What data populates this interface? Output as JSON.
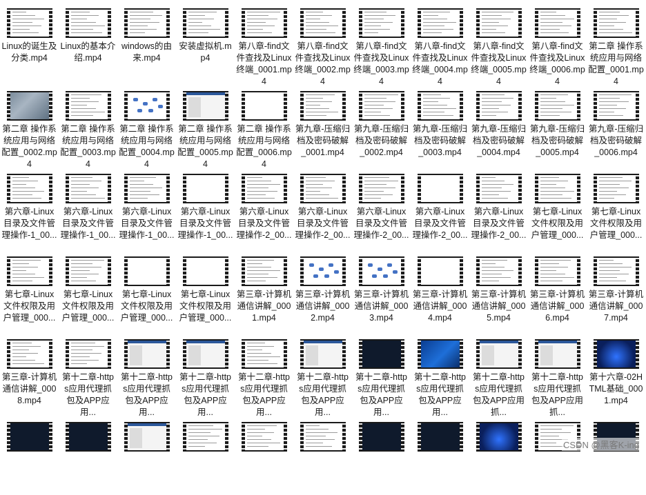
{
  "files": [
    {
      "label": "Linux的诞生及分类.mp4",
      "thumb": "doc"
    },
    {
      "label": "Linux的基本介绍.mp4",
      "thumb": "doc"
    },
    {
      "label": "windows的由来.mp4",
      "thumb": "doc"
    },
    {
      "label": "安装虚拟机.mp4",
      "thumb": "doc"
    },
    {
      "label": "第八章-find文件查找及Linux终端_0001.mp4",
      "thumb": "doc"
    },
    {
      "label": "第八章-find文件查找及Linux终端_0002.mp4",
      "thumb": "doc"
    },
    {
      "label": "第八章-find文件查找及Linux终端_0003.mp4",
      "thumb": "doc"
    },
    {
      "label": "第八章-find文件查找及Linux终端_0004.mp4",
      "thumb": "doc"
    },
    {
      "label": "第八章-find文件查找及Linux终端_0005.mp4",
      "thumb": "doc"
    },
    {
      "label": "第八章-find文件查找及Linux终端_0006.mp4",
      "thumb": "doc"
    },
    {
      "label": "第二章 操作系统应用与网络配置_0001.mp4",
      "thumb": "doc"
    },
    {
      "label": "第二章 操作系统应用与网络配置_0002.mp4",
      "thumb": "blur"
    },
    {
      "label": "第二章 操作系统应用与网络配置_0003.mp4",
      "thumb": "doc"
    },
    {
      "label": "第二章 操作系统应用与网络配置_0004.mp4",
      "thumb": "diag"
    },
    {
      "label": "第二章 操作系统应用与网络配置_0005.mp4",
      "thumb": "app"
    },
    {
      "label": "第二章 操作系统应用与网络配置_0006.mp4",
      "thumb": "blank"
    },
    {
      "label": "第九章-压缩归档及密码破解_0001.mp4",
      "thumb": "doc"
    },
    {
      "label": "第九章-压缩归档及密码破解_0002.mp4",
      "thumb": "doc"
    },
    {
      "label": "第九章-压缩归档及密码破解_0003.mp4",
      "thumb": "doc"
    },
    {
      "label": "第九章-压缩归档及密码破解_0004.mp4",
      "thumb": "doc"
    },
    {
      "label": "第九章-压缩归档及密码破解_0005.mp4",
      "thumb": "doc"
    },
    {
      "label": "第九章-压缩归档及密码破解_0006.mp4",
      "thumb": "doc"
    },
    {
      "label": "第六章-Linux目录及文件管理操作-1_00...",
      "thumb": "doc"
    },
    {
      "label": "第六章-Linux目录及文件管理操作-1_00...",
      "thumb": "doc"
    },
    {
      "label": "第六章-Linux目录及文件管理操作-1_00...",
      "thumb": "doc"
    },
    {
      "label": "第六章-Linux目录及文件管理操作-1_00...",
      "thumb": "blank"
    },
    {
      "label": "第六章-Linux目录及文件管理操作-2_00...",
      "thumb": "doc"
    },
    {
      "label": "第六章-Linux目录及文件管理操作-2_00...",
      "thumb": "doc"
    },
    {
      "label": "第六章-Linux目录及文件管理操作-2_00...",
      "thumb": "doc"
    },
    {
      "label": "第六章-Linux目录及文件管理操作-2_00...",
      "thumb": "blank"
    },
    {
      "label": "第六章-Linux目录及文件管理操作-2_00...",
      "thumb": "doc"
    },
    {
      "label": "第七章-Linux文件权限及用户管理_000...",
      "thumb": "doc"
    },
    {
      "label": "第七章-Linux文件权限及用户管理_000...",
      "thumb": "doc"
    },
    {
      "label": "第七章-Linux文件权限及用户管理_000...",
      "thumb": "doc"
    },
    {
      "label": "第七章-Linux文件权限及用户管理_000...",
      "thumb": "doc"
    },
    {
      "label": "第七章-Linux文件权限及用户管理_000...",
      "thumb": "blank"
    },
    {
      "label": "第七章-Linux文件权限及用户管理_000...",
      "thumb": "blank"
    },
    {
      "label": "第三章-计算机通信讲解_0001.mp4",
      "thumb": "doc"
    },
    {
      "label": "第三章-计算机通信讲解_0002.mp4",
      "thumb": "diag"
    },
    {
      "label": "第三章-计算机通信讲解_0003.mp4",
      "thumb": "diag"
    },
    {
      "label": "第三章-计算机通信讲解_0004.mp4",
      "thumb": "blank"
    },
    {
      "label": "第三章-计算机通信讲解_0005.mp4",
      "thumb": "doc"
    },
    {
      "label": "第三章-计算机通信讲解_0006.mp4",
      "thumb": "doc"
    },
    {
      "label": "第三章-计算机通信讲解_0007.mp4",
      "thumb": "doc"
    },
    {
      "label": "第三章-计算机通信讲解_0008.mp4",
      "thumb": "doc"
    },
    {
      "label": "第十二章-https应用代理抓包及APP应用...",
      "thumb": "doc"
    },
    {
      "label": "第十二章-https应用代理抓包及APP应用...",
      "thumb": "app"
    },
    {
      "label": "第十二章-https应用代理抓包及APP应用...",
      "thumb": "app"
    },
    {
      "label": "第十二章-https应用代理抓包及APP应用...",
      "thumb": "doc"
    },
    {
      "label": "第十二章-https应用代理抓包及APP应用...",
      "thumb": "app"
    },
    {
      "label": "第十二章-https应用代理抓包及APP应用...",
      "thumb": "dark"
    },
    {
      "label": "第十二章-https应用代理抓包及APP应用...",
      "thumb": "desk"
    },
    {
      "label": "第十二章-https应用代理抓包及APP应用抓...",
      "thumb": "app"
    },
    {
      "label": "第十二章-https应用代理抓包及APP应用抓...",
      "thumb": "app"
    },
    {
      "label": "第十六章-02HTML基础_0001.mp4",
      "thumb": "win11"
    },
    {
      "label": "",
      "thumb": "dark"
    },
    {
      "label": "",
      "thumb": "dark"
    },
    {
      "label": "",
      "thumb": "app"
    },
    {
      "label": "",
      "thumb": "doc"
    },
    {
      "label": "",
      "thumb": "doc"
    },
    {
      "label": "",
      "thumb": "doc"
    },
    {
      "label": "",
      "thumb": "dark"
    },
    {
      "label": "",
      "thumb": "dark"
    },
    {
      "label": "",
      "thumb": "win11"
    },
    {
      "label": "",
      "thumb": "doc"
    },
    {
      "label": "",
      "thumb": "dark"
    }
  ],
  "watermark": "CSDN @黑客K-ing"
}
